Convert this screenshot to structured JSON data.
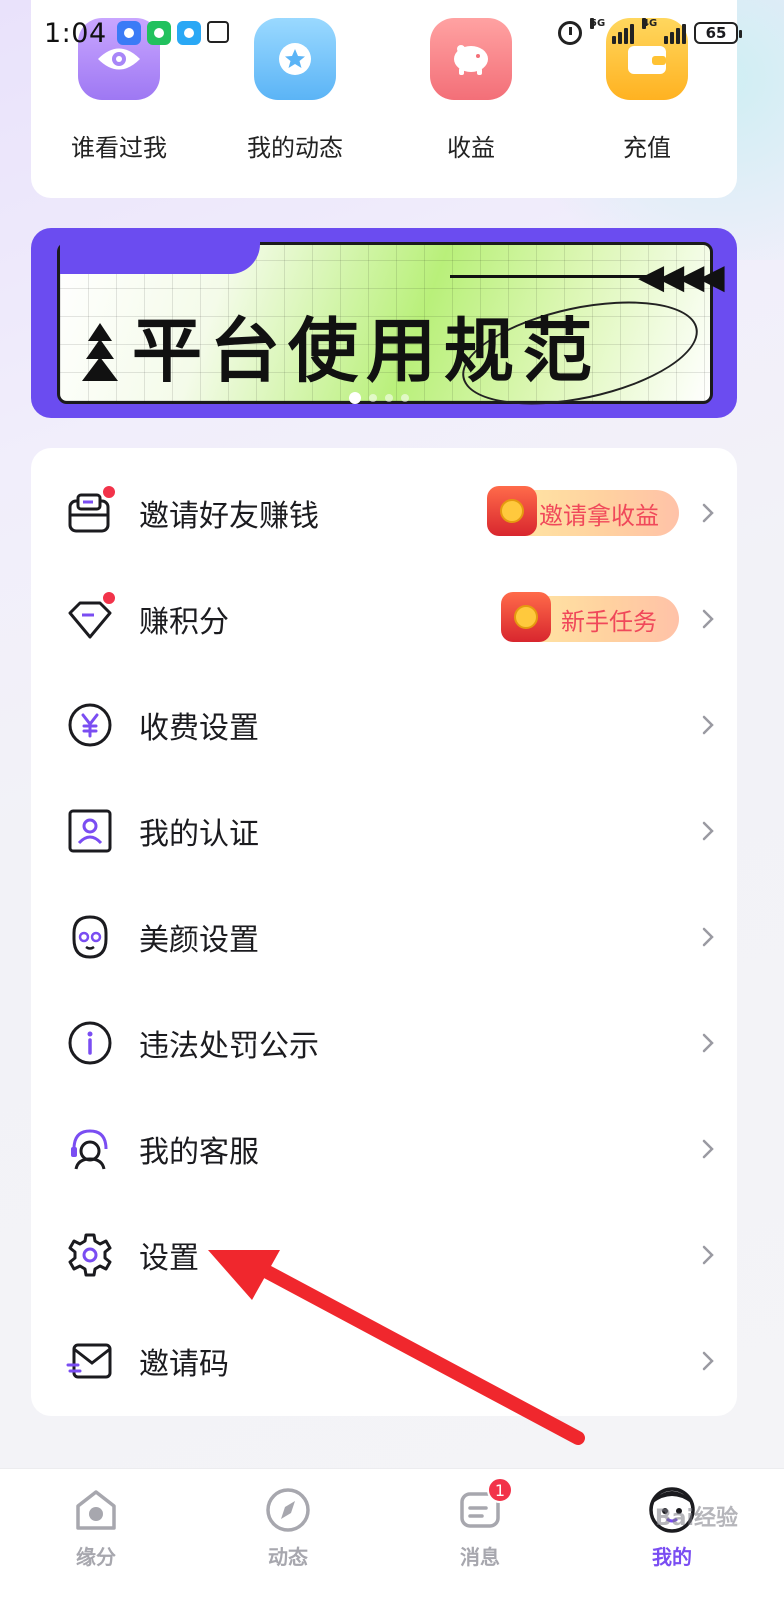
{
  "status_bar": {
    "time": "1:04",
    "network_1": "5G",
    "network_2": "4G",
    "battery": "65"
  },
  "quick_actions": [
    {
      "label": "谁看过我",
      "icon": "eye-icon",
      "color": "#a886f8"
    },
    {
      "label": "我的动态",
      "icon": "star-icon",
      "color": "#6bbef8"
    },
    {
      "label": "收益",
      "icon": "piggy-bank-icon",
      "color": "#f67b83"
    },
    {
      "label": "充值",
      "icon": "wallet-icon",
      "color": "#ffc233"
    }
  ],
  "banner": {
    "title": "平台使用规范",
    "accent_color": "#6b4cf0"
  },
  "menu": {
    "items": [
      {
        "label": "邀请好友赚钱",
        "icon": "invite-envelope-icon",
        "badge_dot": true,
        "promo": "邀请拿收益"
      },
      {
        "label": "赚积分",
        "icon": "diamond-icon",
        "badge_dot": true,
        "promo": "新手任务"
      },
      {
        "label": "收费设置",
        "icon": "yuan-icon"
      },
      {
        "label": "我的认证",
        "icon": "id-card-icon"
      },
      {
        "label": "美颜设置",
        "icon": "face-icon"
      },
      {
        "label": "违法处罚公示",
        "icon": "info-icon"
      },
      {
        "label": "我的客服",
        "icon": "headset-icon"
      },
      {
        "label": "设置",
        "icon": "gear-icon"
      },
      {
        "label": "邀请码",
        "icon": "mail-icon"
      }
    ]
  },
  "bottom_nav": {
    "items": [
      {
        "label": "缘分",
        "icon": "home-icon",
        "active": false
      },
      {
        "label": "动态",
        "icon": "compass-icon",
        "active": false
      },
      {
        "label": "消息",
        "icon": "message-icon",
        "active": false,
        "badge": "1"
      },
      {
        "label": "我的",
        "icon": "profile-face-icon",
        "active": true
      }
    ],
    "active_color": "#7a4df2"
  },
  "watermark": "Bai经验"
}
